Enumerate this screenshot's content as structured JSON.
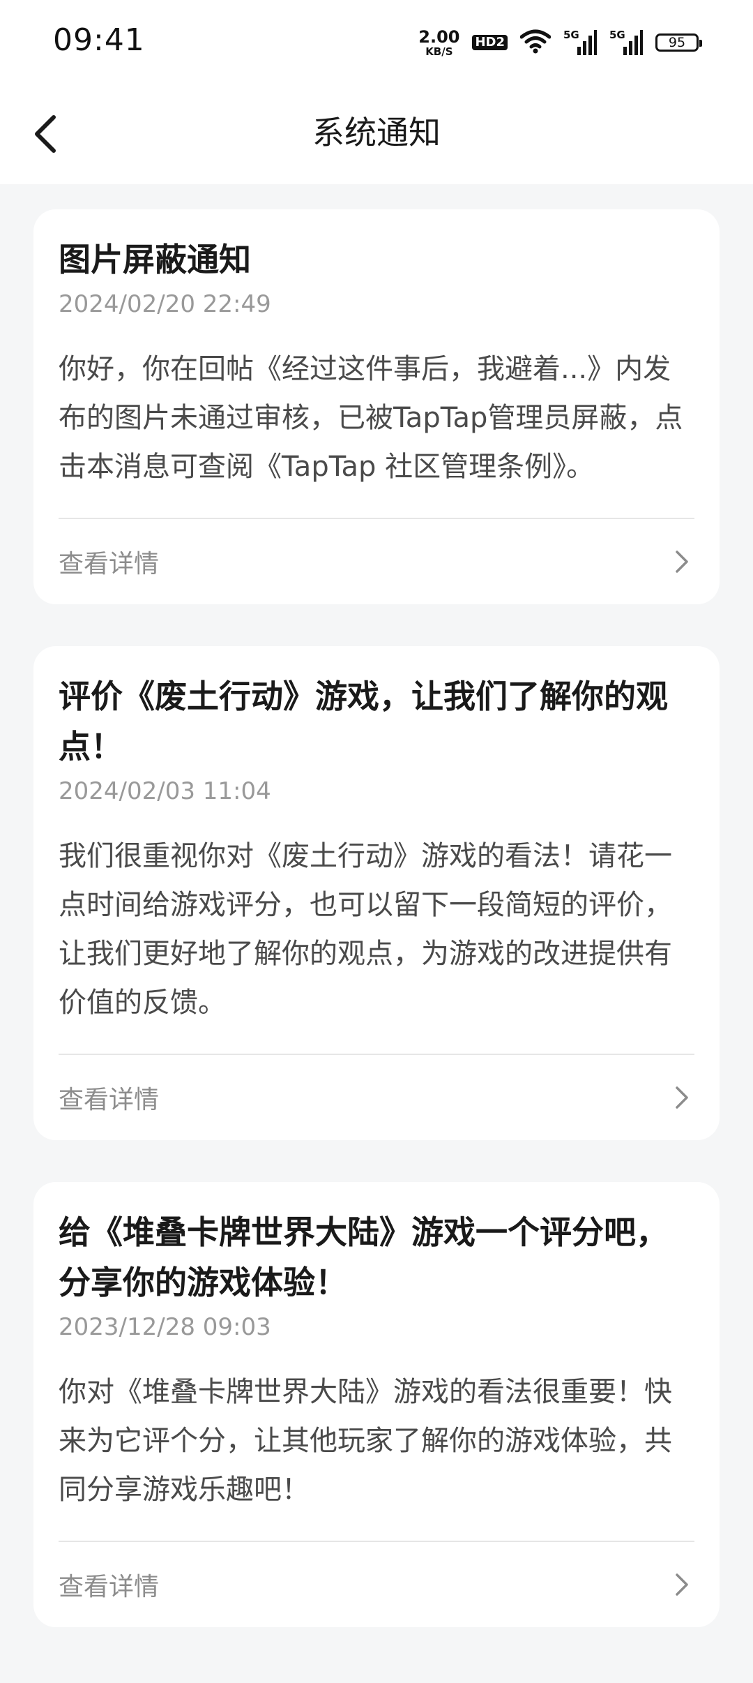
{
  "status_bar": {
    "time": "09:41",
    "speed_value": "2.00",
    "speed_unit": "KB/S",
    "hd_label": "HD2",
    "net1_label": "5G",
    "net2_label": "5G",
    "battery_level": "95",
    "icons": [
      "wifi-icon",
      "signal-icon",
      "signal-icon",
      "battery-icon"
    ]
  },
  "header": {
    "title": "系统通知",
    "back_icon": "chevron-left-icon"
  },
  "notifications": [
    {
      "title": "图片屏蔽通知",
      "time": "2024/02/20 22:49",
      "body": "你好，你在回帖《经过这件事后，我避着...》内发布的图片未通过审核，已被TapTap管理员屏蔽，点击本消息可查阅《TapTap 社区管理条例》。",
      "action_label": "查看详情"
    },
    {
      "title": "评价《废土行动》游戏，让我们了解你的观点！",
      "time": "2024/02/03 11:04",
      "body": "我们很重视你对《废土行动》游戏的看法！请花一点时间给游戏评分，也可以留下一段简短的评价，让我们更好地了解你的观点，为游戏的改进提供有价值的反馈。",
      "action_label": "查看详情"
    },
    {
      "title": "给《堆叠卡牌世界大陆》游戏一个评分吧，分享你的游戏体验！",
      "time": "2023/12/28 09:03",
      "body": "你对《堆叠卡牌世界大陆》游戏的看法很重要！快来为它评个分，让其他玩家了解你的游戏体验，共同分享游戏乐趣吧！",
      "action_label": "查看详情"
    }
  ]
}
